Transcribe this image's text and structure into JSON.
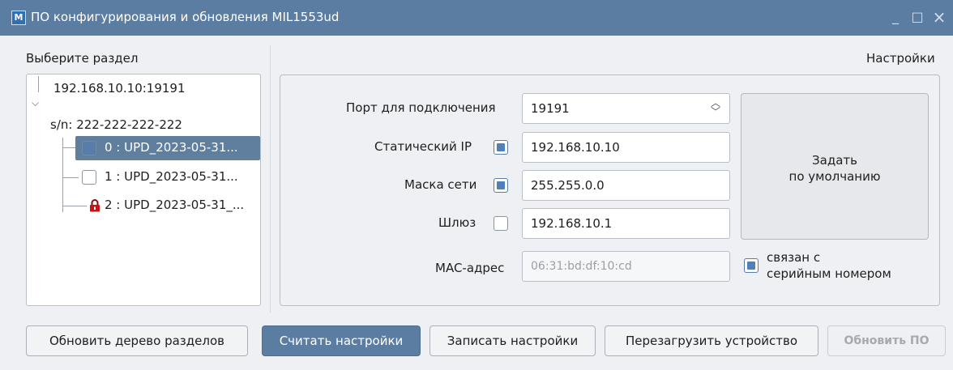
{
  "window": {
    "title": "ПО конфигурирования и обновления MIL1553ud",
    "icon": "app-logo-icon",
    "controls": {
      "minimize": "_",
      "maximize": "□",
      "close": "×"
    }
  },
  "left": {
    "section_label": "Выберите раздел",
    "tree": {
      "root": "192.168.10.10:19191",
      "device": "s/n: 222-222-222-222",
      "items": [
        {
          "label": "0 : UPD_2023-05-31...",
          "state": "selected",
          "icon": "checkbox-checked-icon"
        },
        {
          "label": "1 : UPD_2023-05-31...",
          "state": "unchecked",
          "icon": "checkbox-icon"
        },
        {
          "label": "2 : UPD_2023-05-31_...",
          "state": "locked",
          "icon": "lock-icon"
        }
      ]
    }
  },
  "settings": {
    "heading": "Настройки",
    "port": {
      "label": "Порт для подключения",
      "value": "19191"
    },
    "static_ip": {
      "label": "Статический IP",
      "checked": true,
      "value": "192.168.10.10"
    },
    "netmask": {
      "label": "Маска сети",
      "checked": true,
      "value": "255.255.0.0"
    },
    "gateway": {
      "label": "Шлюз",
      "checked": false,
      "value": "192.168.10.1"
    },
    "mac": {
      "label": "MAC-адрес",
      "value": "06:31:bd:df:10:cd"
    },
    "serial_link": {
      "checked": true,
      "line1": "связан с",
      "line2": "серийным номером"
    },
    "defaults_button": {
      "line1": "Задать",
      "line2": "по умолчанию"
    }
  },
  "buttons": {
    "refresh_tree": "Обновить дерево разделов",
    "read_settings": "Считать настройки",
    "write_settings": "Записать настройки",
    "reboot": "Перезагрузить устройство",
    "update_fw": "Обновить ПО"
  },
  "colors": {
    "titlebar": "#5b7da1",
    "selection": "#607f9f",
    "primary_button": "#5b7da1",
    "lock": "#d01010"
  }
}
